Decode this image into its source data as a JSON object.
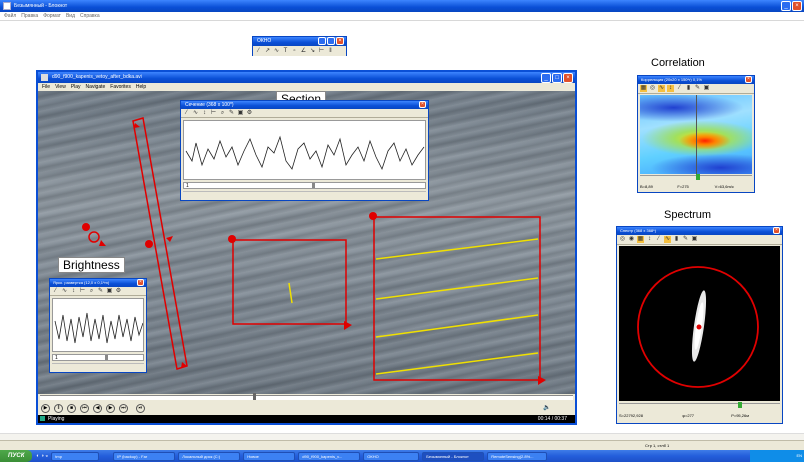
{
  "app_title": "Безымянный - Блокнот",
  "app_menu": [
    "Файл",
    "Правка",
    "Формат",
    "Вид",
    "Справка"
  ],
  "calc_win_title": "ОКНО",
  "video": {
    "title": "d90_f900_kapenis_vetoy_after_bdka.avi",
    "menu": [
      "File",
      "View",
      "Play",
      "Navigate",
      "Favorites",
      "Help"
    ],
    "status": "Playing",
    "time": "00:14 / 00:37"
  },
  "section": {
    "label": "Section",
    "win_title": "Сечение (368 x 100*)",
    "slider_value": "1"
  },
  "brightness": {
    "label": "Brightness",
    "win_title": "Ярко. развертка (12,0 x 0,1*m)",
    "slider_value": "1"
  },
  "correlation": {
    "label": "Correlation",
    "win_title": "Корреляция (20x20 x 150*r) 0,1%",
    "b": "B=8,89",
    "f": "F=275",
    "v": "V=63,6m/c"
  },
  "spectrum": {
    "label": "Spectrum",
    "win_title": "Спектр (368 x 368*)",
    "s": "S=22792,928",
    "phi": "φ=277",
    "p": "P=95,26м"
  },
  "status_bar": "Стр 1, стлб 1",
  "taskbar": {
    "start": "ПУСК",
    "tasks": [
      "tmp",
      "IP (backup) - Far",
      "Локальный диск (C:)",
      "Новое",
      "d90_f900_kapenis_v...",
      "ОКНО",
      "Безымянный - Блокнот",
      "RemoteSensing(2.8%..."
    ],
    "tray": "EN"
  },
  "colors": {
    "xp_blue": "#0a4fd6",
    "red": "#e00000",
    "yellow": "#f0e000"
  }
}
